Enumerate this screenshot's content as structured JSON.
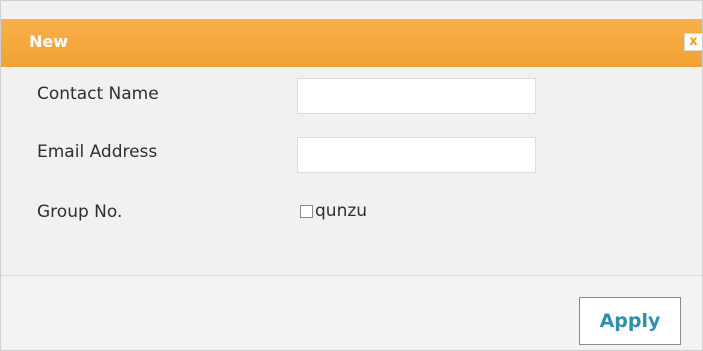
{
  "dialog": {
    "title": "New",
    "close_label": "x"
  },
  "form": {
    "contact_name": {
      "label": "Contact Name",
      "value": ""
    },
    "email_address": {
      "label": "Email Address",
      "value": ""
    },
    "group_no": {
      "label": "Group No.",
      "option_label": "qunzu",
      "checked": false
    }
  },
  "footer": {
    "apply_label": "Apply"
  },
  "colors": {
    "titlebar": "#f2a233",
    "title_text": "#ffffff",
    "close_icon": "#f29a28",
    "apply_text": "#2f8fae",
    "background": "#f1f1f1"
  },
  "icons": {
    "close": "close-icon"
  }
}
